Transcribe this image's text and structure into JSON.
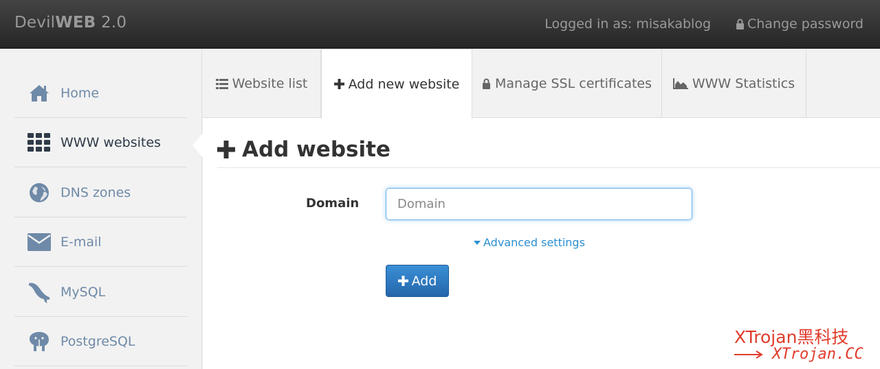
{
  "topbar": {
    "brand_prefix": "Devil",
    "brand_bold": "WEB",
    "brand_suffix": " 2.0",
    "logged_in": "Logged in as: misakablog",
    "change_password": "Change password"
  },
  "sidebar": {
    "items": [
      {
        "label": "Home",
        "icon": "home-icon"
      },
      {
        "label": "WWW websites",
        "icon": "grid-icon",
        "active": true
      },
      {
        "label": "DNS zones",
        "icon": "globe-icon"
      },
      {
        "label": "E-mail",
        "icon": "envelope-icon"
      },
      {
        "label": "MySQL",
        "icon": "dolphin-icon"
      },
      {
        "label": "PostgreSQL",
        "icon": "elephant-icon"
      }
    ]
  },
  "tabs": [
    {
      "label": "Website list",
      "icon": "list-icon"
    },
    {
      "label": "Add new website",
      "icon": "plus-icon",
      "active": true
    },
    {
      "label": "Manage SSL certificates",
      "icon": "lock-icon"
    },
    {
      "label": "WWW Statistics",
      "icon": "area-chart-icon"
    }
  ],
  "form": {
    "heading": "Add website",
    "domain_label": "Domain",
    "domain_placeholder": "Domain",
    "domain_value": "",
    "advanced_settings": "Advanced settings",
    "add_button": "Add"
  },
  "watermark": {
    "line1": "XTrojan黑科技",
    "line2": "XTrojan.CC"
  },
  "colors": {
    "link": "#2a8fd0",
    "primary_button": "#2e78c2",
    "sidebar_text": "#6f8aa8",
    "watermark": "#e03c2c"
  }
}
